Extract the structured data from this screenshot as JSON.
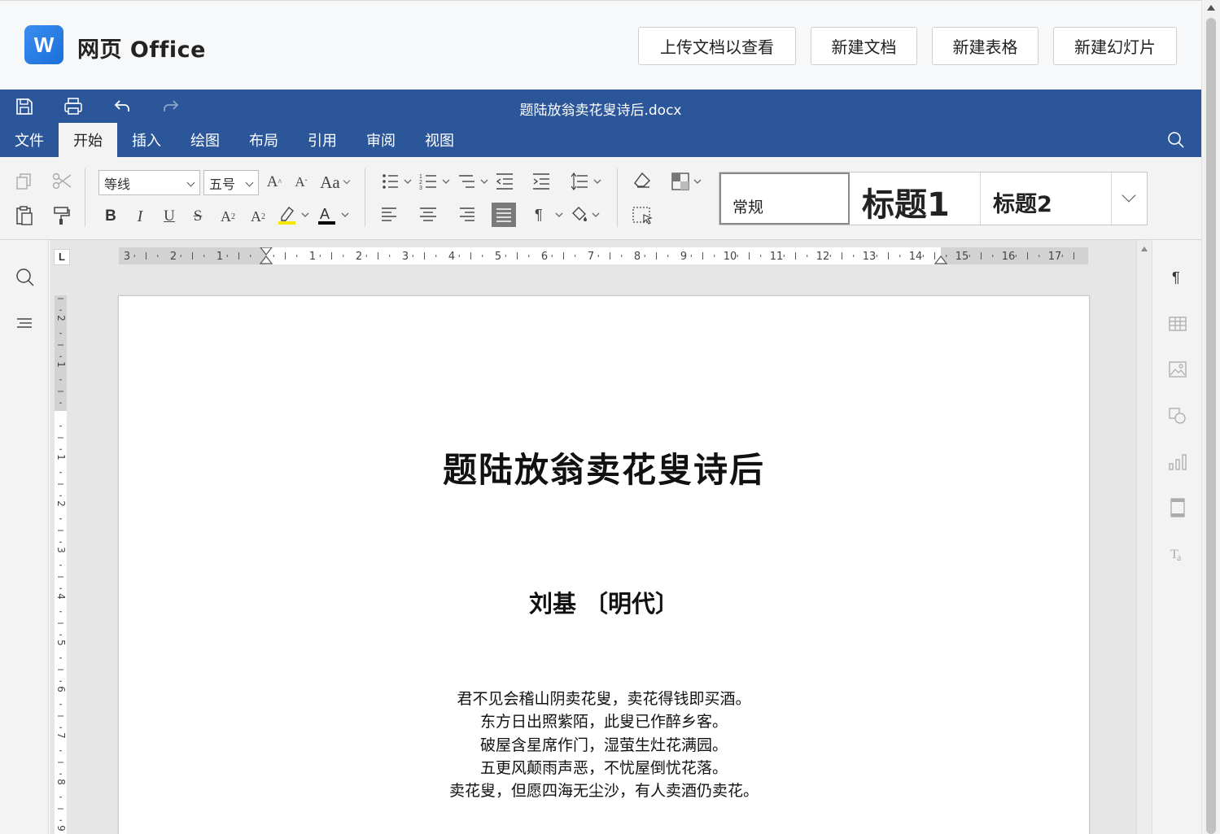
{
  "app": {
    "logo_letter": "W",
    "title": "网页 Office",
    "buttons": [
      "上传文档以查看",
      "新建文档",
      "新建表格",
      "新建幻灯片"
    ]
  },
  "document": {
    "filename": "题陆放翁卖花叟诗后.docx",
    "title": "题陆放翁卖花叟诗后",
    "author": "刘基 〔明代〕",
    "lines": [
      "君不见会稽山阴卖花叟，卖花得钱即买酒。",
      "东方日出照紫陌，此叟已作醉乡客。",
      "破屋含星席作门，湿萤生灶花满园。",
      "五更风颠雨声恶，不忧屋倒忧花落。",
      "卖花叟，但愿四海无尘沙，有人卖酒仍卖花。"
    ]
  },
  "menu": {
    "tabs": [
      "文件",
      "开始",
      "插入",
      "绘图",
      "布局",
      "引用",
      "审阅",
      "视图"
    ],
    "active": "开始"
  },
  "ribbon": {
    "font_name": "等线",
    "font_size": "五号",
    "styles": {
      "normal": "常规",
      "h1": "标题1",
      "h2": "标题2"
    },
    "highlight_color": "#f5e800",
    "font_color": "#000000"
  },
  "ruler": {
    "h_left_numbers": [
      "3",
      "2",
      "1"
    ],
    "h_numbers": [
      "1",
      "2",
      "3",
      "4",
      "5",
      "6",
      "7",
      "8",
      "9",
      "10",
      "11",
      "12",
      "13",
      "14",
      "15",
      "16",
      "17"
    ],
    "v_top_numbers": [
      "2",
      "1"
    ],
    "v_numbers": [
      "1",
      "2",
      "3",
      "4",
      "5",
      "6",
      "7",
      "8",
      "9"
    ]
  },
  "colors": {
    "brand": "#2b579a",
    "logo": "#1a73e8"
  }
}
